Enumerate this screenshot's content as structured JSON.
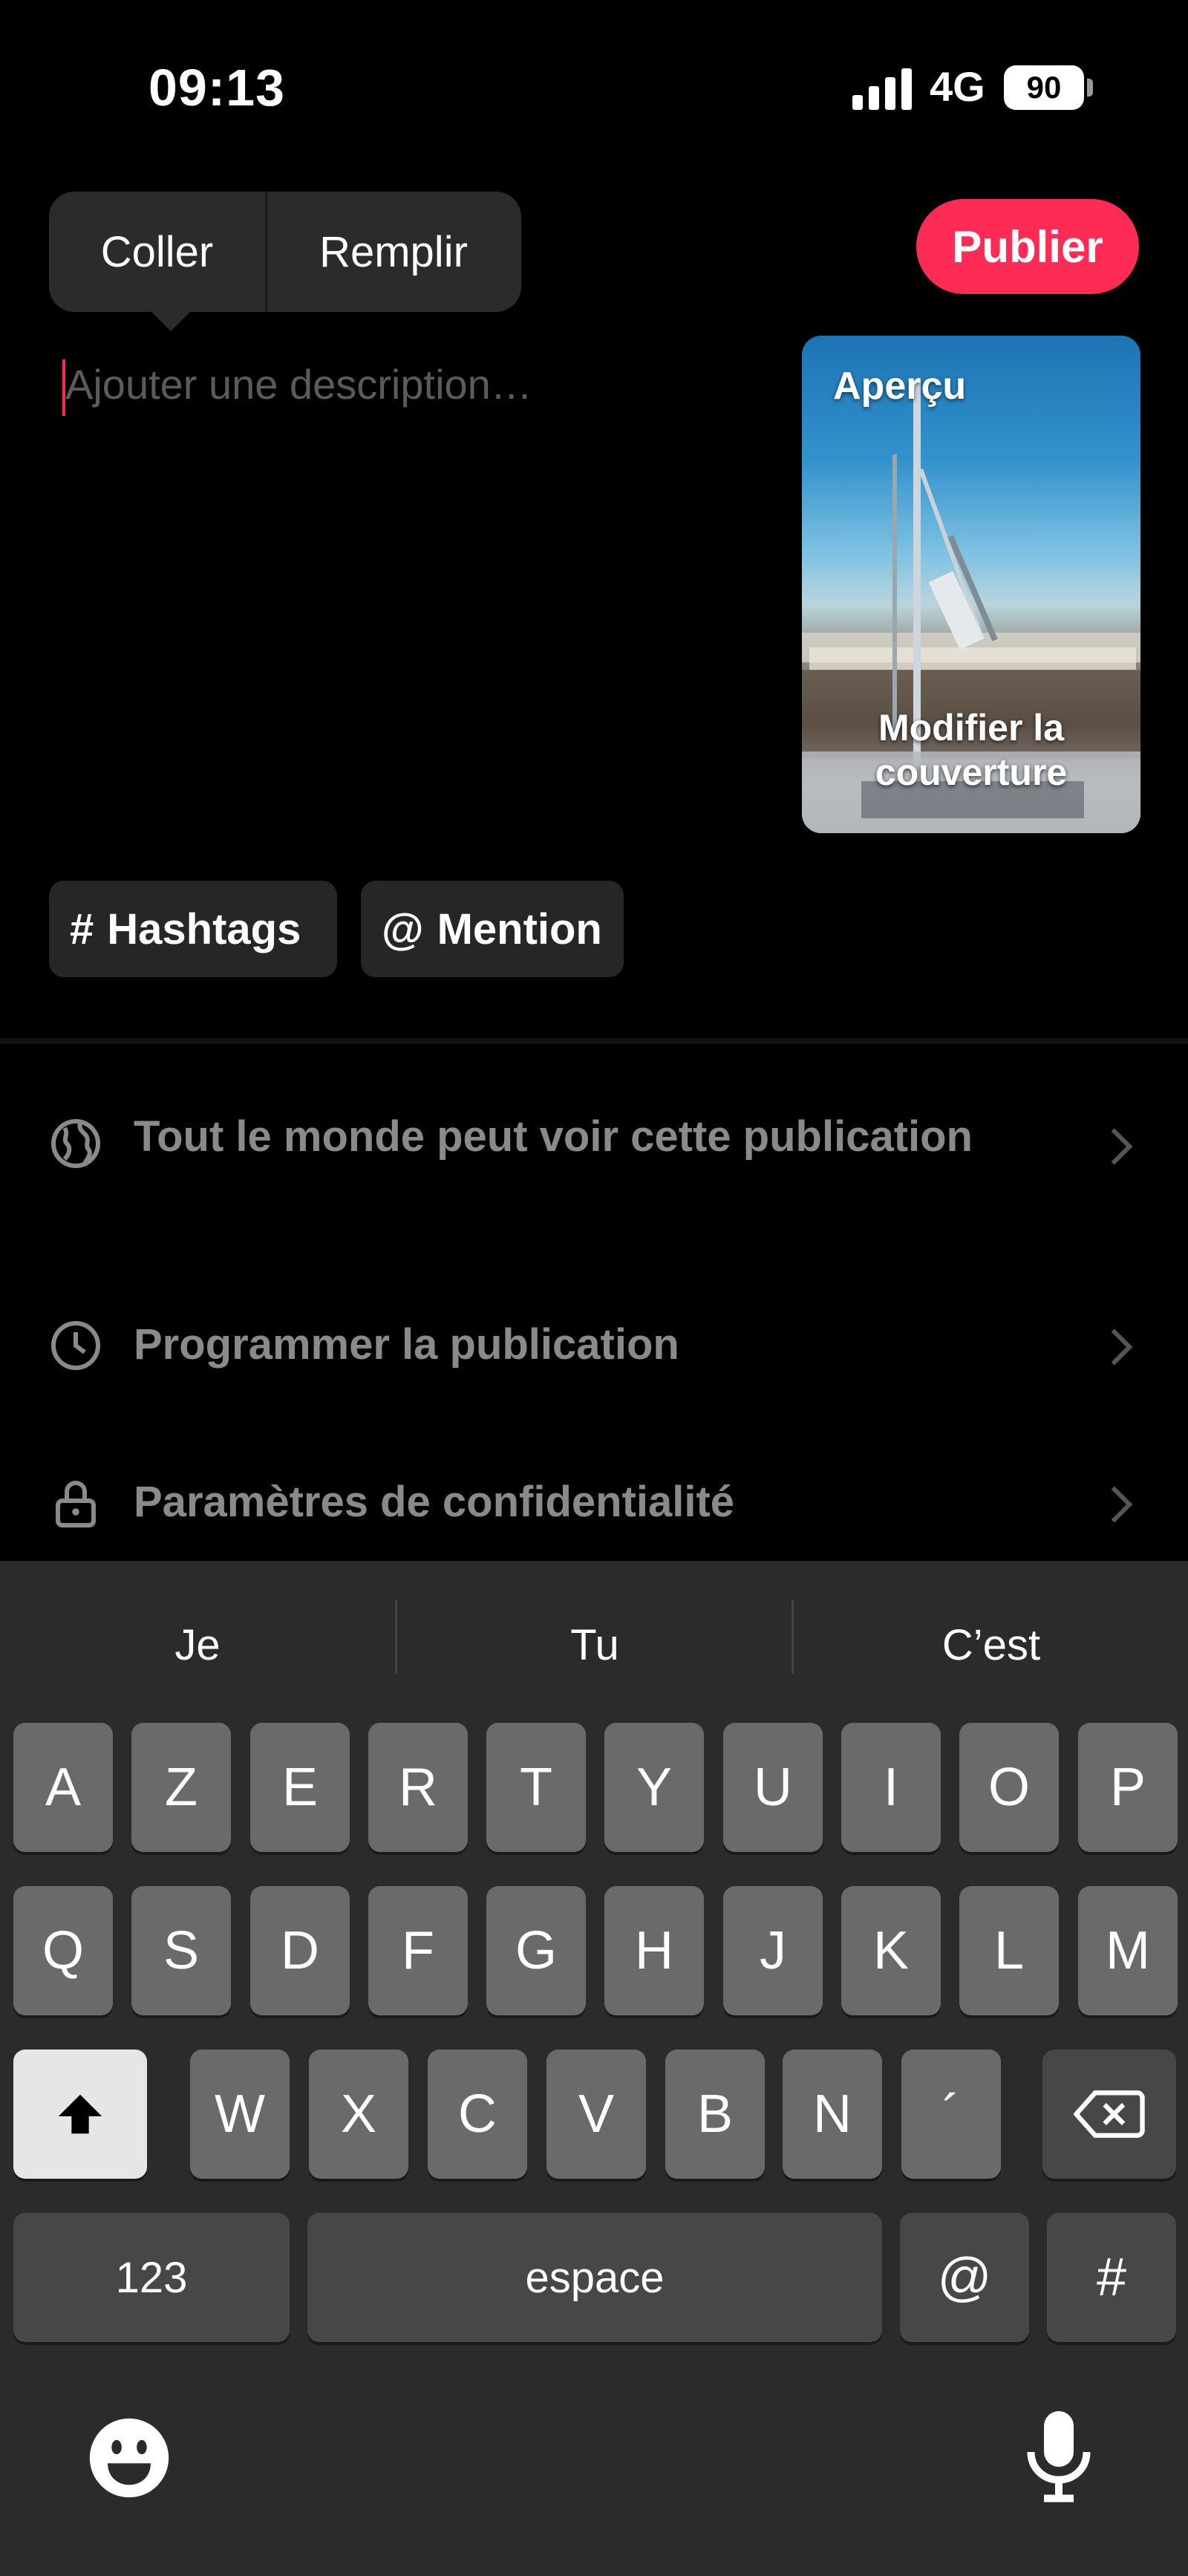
{
  "status_bar": {
    "time": "09:13",
    "network": "4G",
    "battery": "90"
  },
  "edit_menu": {
    "paste": "Coller",
    "autofill": "Remplir"
  },
  "publish_label": "Publier",
  "description": {
    "placeholder": "Ajouter une description…",
    "value": ""
  },
  "preview": {
    "label": "Aperçu",
    "edit_cover": [
      "Modifier la",
      "couverture"
    ]
  },
  "chips": {
    "hashtags": {
      "glyph": "#",
      "label": "Hashtags"
    },
    "mention": {
      "glyph": "@",
      "label": "Mention"
    }
  },
  "settings": [
    {
      "icon": "globe-icon",
      "label": "Tout le monde peut voir cette publication"
    },
    {
      "icon": "clock-icon",
      "label": "Programmer la publication"
    },
    {
      "icon": "lock-icon",
      "label": "Paramètres de confidentialité"
    }
  ],
  "keyboard": {
    "suggestions": [
      "Je",
      "Tu",
      "C’est"
    ],
    "row1": [
      "A",
      "Z",
      "E",
      "R",
      "T",
      "Y",
      "U",
      "I",
      "O",
      "P"
    ],
    "row2": [
      "Q",
      "S",
      "D",
      "F",
      "G",
      "H",
      "J",
      "K",
      "L",
      "M"
    ],
    "row3": [
      "W",
      "X",
      "C",
      "V",
      "B",
      "N",
      "´"
    ],
    "numbers": "123",
    "space": "espace",
    "at": "@",
    "hash": "#"
  },
  "colors": {
    "accent": "#fe2c55",
    "keyboard_bg": "#2b2b2b",
    "key": "#6a6a6a",
    "key_dark": "#474747"
  }
}
